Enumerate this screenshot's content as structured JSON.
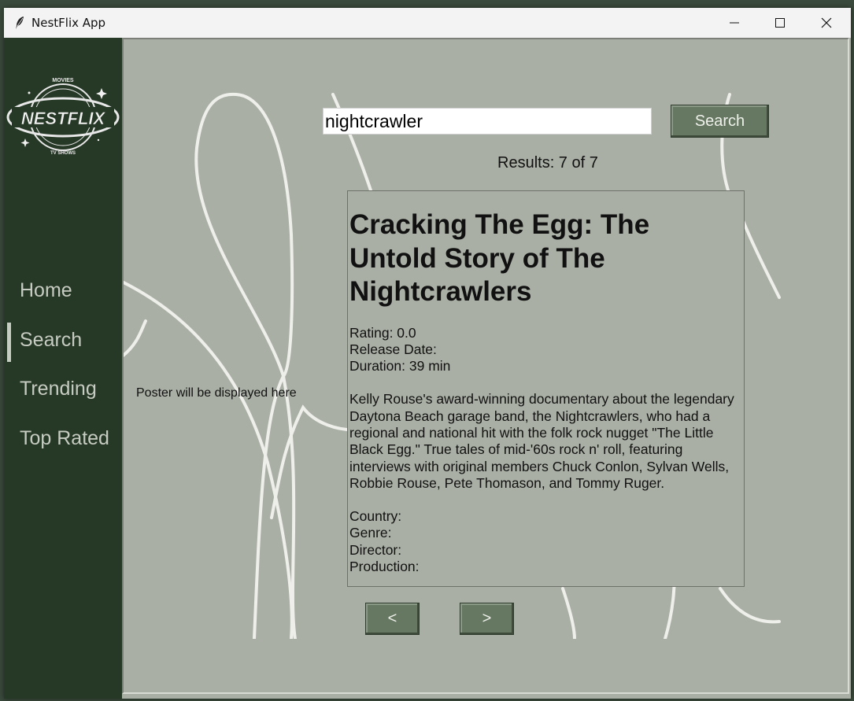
{
  "window": {
    "title": "NestFlix App",
    "icon": "feather-icon",
    "controls": [
      "minimize-icon",
      "maximize-icon",
      "close-icon"
    ]
  },
  "sidebar": {
    "logo": {
      "top": "MOVIES",
      "main": "NESTFLIX",
      "bottom": "TV SHOWS"
    },
    "items": [
      {
        "label": "Home",
        "active": false
      },
      {
        "label": "Search",
        "active": true
      },
      {
        "label": "Trending",
        "active": false
      },
      {
        "label": "Top Rated",
        "active": false
      }
    ]
  },
  "search": {
    "value": "nightcrawler",
    "button_label": "Search",
    "results_text": "Results: 7 of 7"
  },
  "poster": {
    "placeholder": "Poster will be displayed here"
  },
  "detail": {
    "title": "Cracking The Egg: The Untold Story of The Nightcrawlers",
    "rating": "Rating: 0.0",
    "release_date": "Release Date:",
    "duration": "Duration: 39 min",
    "description": "Kelly Rouse's award-winning documentary about the legendary Daytona Beach garage band, the Nightcrawlers, who had a regional and national hit with the folk rock nugget \"The Little Black Egg.\" True tales of mid-'60s rock n' roll, featuring interviews with original members Chuck Conlon, Sylvan Wells, Robbie Rouse, Pete Thomason, and Tommy Ruger.",
    "country": "Country:",
    "genre": "Genre:",
    "director": "Director:",
    "production": "Production:"
  },
  "pagination": {
    "prev_label": "<",
    "next_label": ">"
  },
  "colors": {
    "sidebar_bg": "#263826",
    "main_bg": "#a9afa4",
    "button_bg": "#667862",
    "nav_text": "#c7ccc2"
  }
}
